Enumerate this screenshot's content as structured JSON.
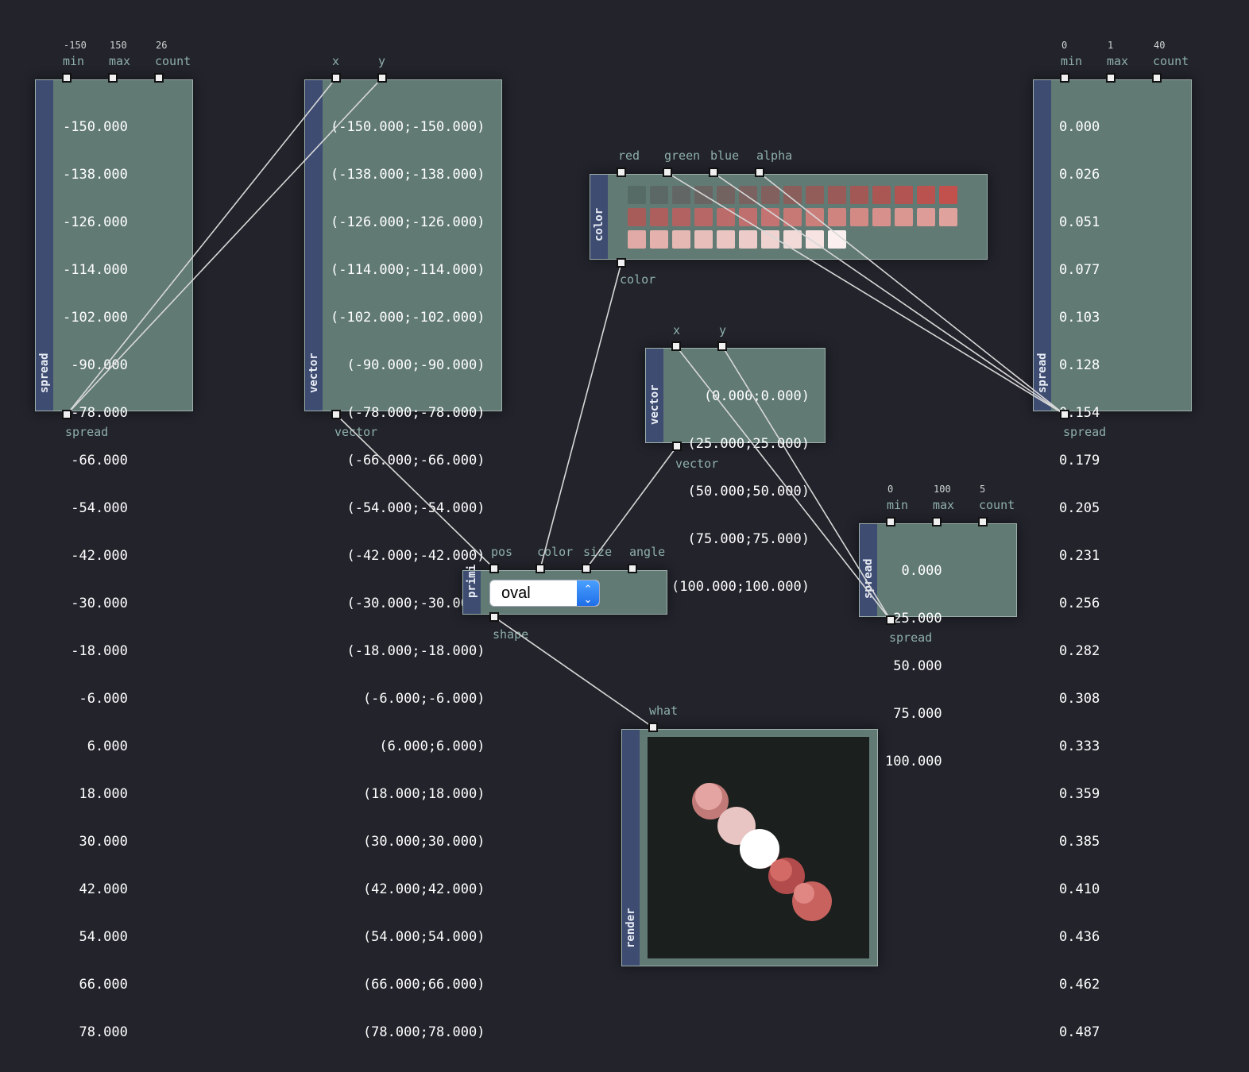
{
  "nodes": {
    "spread1": {
      "title": "spread",
      "params": {
        "min": "-150",
        "max": "150",
        "count": "26"
      },
      "inputs": [
        "min",
        "max",
        "count"
      ],
      "output": "spread",
      "values": [
        "-150.000",
        "-138.000",
        "-126.000",
        "-114.000",
        "-102.000",
        " -90.000",
        " -78.000",
        " -66.000",
        " -54.000",
        " -42.000",
        " -30.000",
        " -18.000",
        "  -6.000",
        "   6.000",
        "  18.000",
        "  30.000",
        "  42.000",
        "  54.000",
        "  66.000",
        "  78.000"
      ]
    },
    "vector1": {
      "title": "vector",
      "inputs": [
        "x",
        "y"
      ],
      "output": "vector",
      "values": [
        "(-150.000;-150.000)",
        "(-138.000;-138.000)",
        "(-126.000;-126.000)",
        "(-114.000;-114.000)",
        "(-102.000;-102.000)",
        "  (-90.000;-90.000)",
        "  (-78.000;-78.000)",
        "  (-66.000;-66.000)",
        "  (-54.000;-54.000)",
        "  (-42.000;-42.000)",
        "  (-30.000;-30.000)",
        "  (-18.000;-18.000)",
        "    (-6.000;-6.000)",
        "      (6.000;6.000)",
        "    (18.000;18.000)",
        "    (30.000;30.000)",
        "    (42.000;42.000)",
        "    (54.000;54.000)",
        "    (66.000;66.000)",
        "    (78.000;78.000)"
      ]
    },
    "color": {
      "title": "color",
      "inputs": [
        "red",
        "green",
        "blue",
        "alpha"
      ],
      "output": "color",
      "swatch_rows": [
        [
          "#566a66",
          "#5b6866",
          "#626765",
          "#6a6563",
          "#726361",
          "#79625f",
          "#82605d",
          "#8a5e5b",
          "#925c59",
          "#9a5a57",
          "#a25855",
          "#aa5653",
          "#b25451",
          "#ba524f",
          "#c2504d"
        ],
        [
          "#a85c5a",
          "#ad5f5d",
          "#b26361",
          "#b76765",
          "#bb6b69",
          "#bf6f6d",
          "#c37472",
          "#c77976",
          "#cb7f7b",
          "#cf8480",
          "#d38a85",
          "#d7908b",
          "#da9691",
          "#dd9c97",
          "#e0a29d"
        ],
        [
          "#e2aaa6",
          "#e4b1ad",
          "#e6b8b4",
          "#e8bebb",
          "#ebc5c2",
          "#edcbc9",
          "#efd3d1",
          "#f2dad9",
          "#f6e3e2",
          "#fbf0ef"
        ]
      ]
    },
    "vector2": {
      "title": "vector",
      "inputs": [
        "x",
        "y"
      ],
      "output": "vector",
      "values": [
        "    (0.000;0.000)",
        "  (25.000;25.000)",
        "  (50.000;50.000)",
        "  (75.000;75.000)",
        "(100.000;100.000)"
      ]
    },
    "spread2": {
      "title": "spread",
      "params": {
        "min": "0",
        "max": "1",
        "count": "40"
      },
      "inputs": [
        "min",
        "max",
        "count"
      ],
      "output": "spread",
      "values": [
        "0.000",
        "0.026",
        "0.051",
        "0.077",
        "0.103",
        "0.128",
        "0.154",
        "0.179",
        "0.205",
        "0.231",
        "0.256",
        "0.282",
        "0.308",
        "0.333",
        "0.359",
        "0.385",
        "0.410",
        "0.436",
        "0.462",
        "0.487"
      ]
    },
    "spread3": {
      "title": "spread",
      "params": {
        "min": "0",
        "max": "100",
        "count": "5"
      },
      "inputs": [
        "min",
        "max",
        "count"
      ],
      "output": "spread",
      "values": [
        "  0.000",
        " 25.000",
        " 50.000",
        " 75.000",
        "100.000"
      ]
    },
    "primitive": {
      "title": "primi",
      "inputs": [
        "pos",
        "color",
        "size",
        "angle"
      ],
      "output": "shape",
      "shape_value": "oval"
    },
    "render": {
      "title": "render",
      "inputs": [
        "what"
      ]
    }
  }
}
